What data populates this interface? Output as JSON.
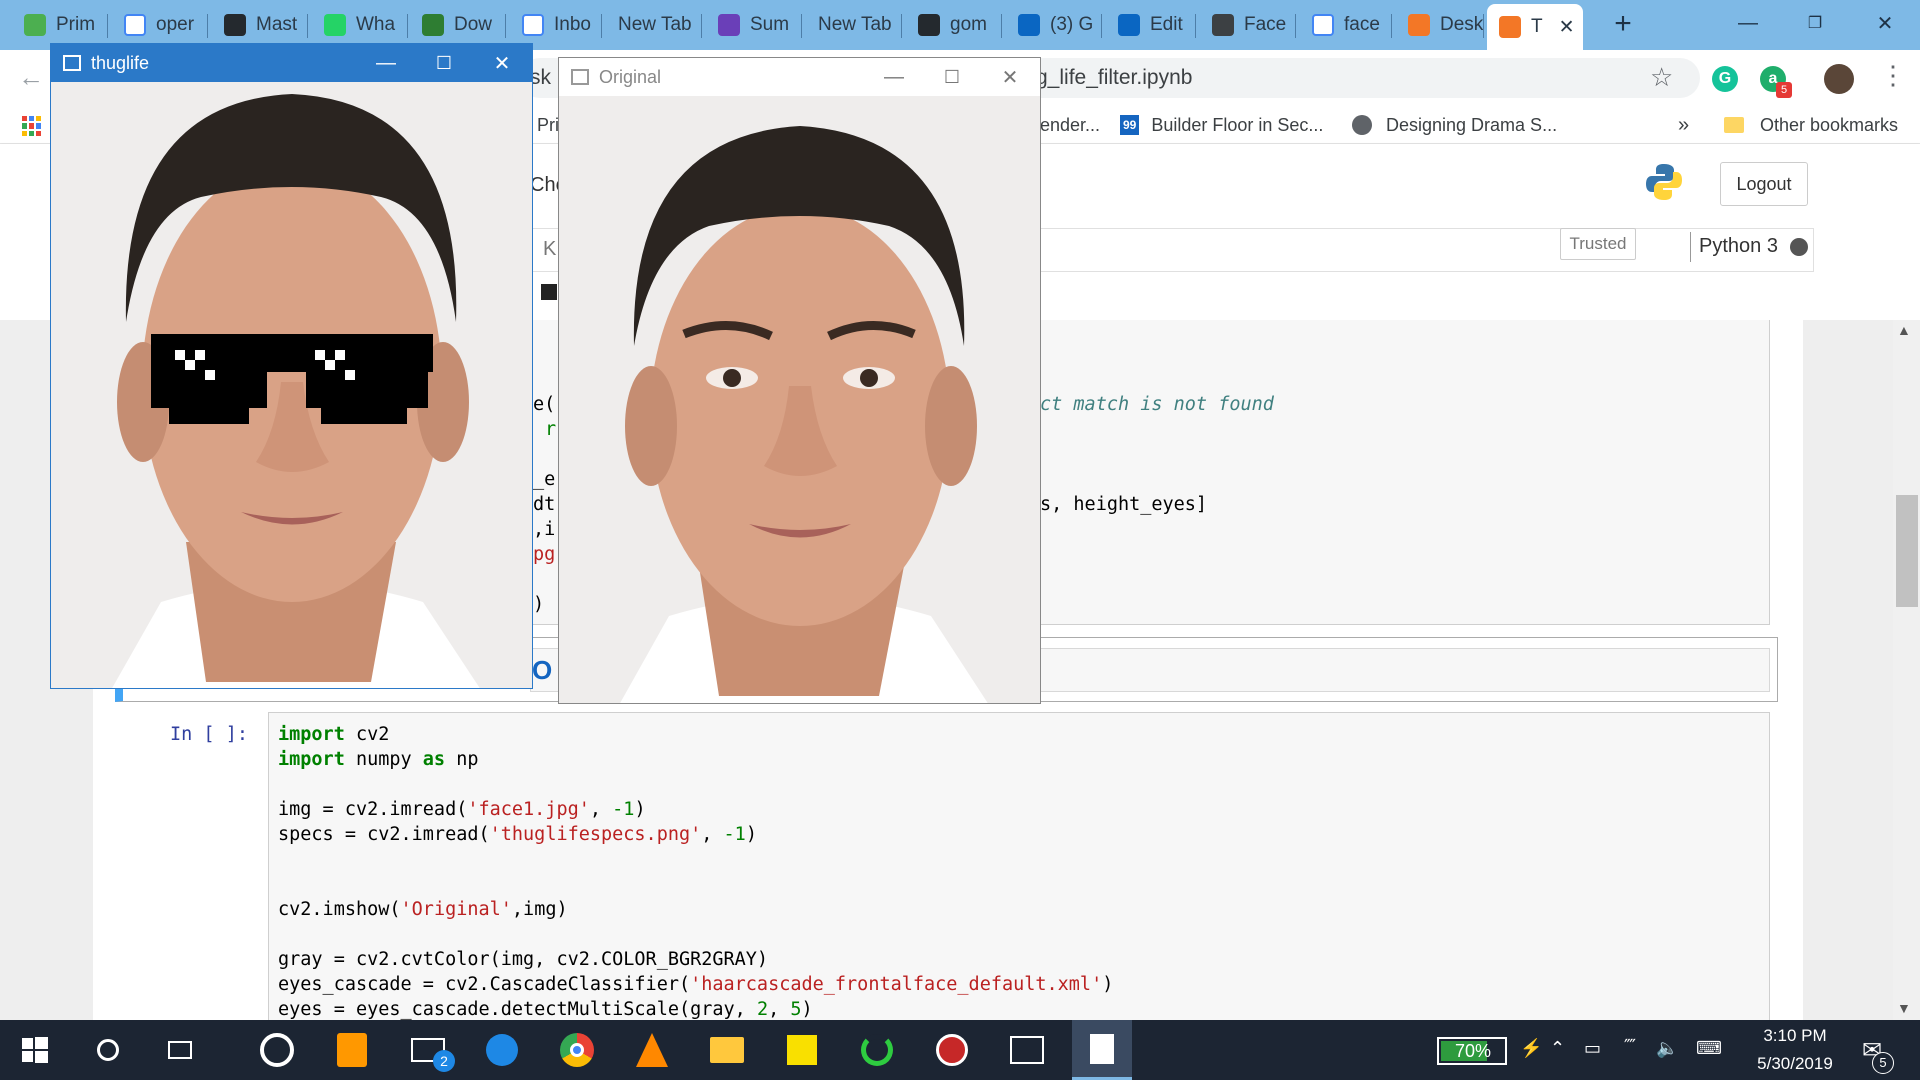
{
  "browser": {
    "tabs": [
      {
        "label": "Prim",
        "favicon": "play-icon",
        "color": "#4caf50"
      },
      {
        "label": "oper",
        "favicon": "google-icon",
        "color": "#ffffff"
      },
      {
        "label": "Mast",
        "favicon": "github-icon",
        "color": "#24292e"
      },
      {
        "label": "Wha",
        "favicon": "whatsapp-icon",
        "color": "#25d366"
      },
      {
        "label": "Dow",
        "favicon": "ftu-icon",
        "color": "#2e7d32"
      },
      {
        "label": "Inbo",
        "favicon": "gmail-icon",
        "color": "#ffffff"
      },
      {
        "label": "New Tab",
        "favicon": "",
        "color": ""
      },
      {
        "label": "Sum",
        "favicon": "list-icon",
        "color": "#6a3fb8"
      },
      {
        "label": "New Tab",
        "favicon": "",
        "color": ""
      },
      {
        "label": "gom",
        "favicon": "github-icon",
        "color": "#24292e"
      },
      {
        "label": "(3) G",
        "favicon": "linkedin-icon",
        "color": "#0a66c2"
      },
      {
        "label": "Edit",
        "favicon": "linkedin-icon",
        "color": "#0a66c2"
      },
      {
        "label": "Face",
        "favicon": "book-icon",
        "color": "#3c4043"
      },
      {
        "label": "face",
        "favicon": "google-icon",
        "color": "#ffffff"
      },
      {
        "label": "Desk",
        "favicon": "jupyter-icon",
        "color": "#f37726"
      },
      {
        "label": "T",
        "favicon": "hourglass-icon",
        "color": "#f37726",
        "active": true
      }
    ],
    "new_tab_label": "+",
    "address": "g_life_filter.ipynb",
    "address_left_fragment": "sk",
    "bookmarks": [
      {
        "label": "Pri"
      },
      {
        "label": "ender..."
      },
      {
        "label": "Builder Floor in Sec...",
        "badge": "99"
      },
      {
        "label": "Designing Drama S..."
      }
    ],
    "bookmarks_more": "»",
    "other_bookmarks": "Other bookmarks",
    "profile_badge": "5"
  },
  "jupyter": {
    "logout_label": "Logout",
    "trusted_label": "Trusted",
    "kernel_label": "Python 3",
    "header_fragment_che": "Che",
    "header_fragment_k": "K",
    "prompt": "In [ ]:",
    "comment_text": "ct match is not found",
    "partial_line": "s, height_eyes]",
    "frag_lines": [
      "e(",
      "r",
      "_e",
      "dt",
      ",i",
      "pg",
      ")"
    ],
    "markdown_fragment": "O",
    "code_lines": [
      [
        {
          "t": "import",
          "c": "kw"
        },
        {
          "t": " cv2",
          "c": ""
        }
      ],
      [
        {
          "t": "import",
          "c": "kw"
        },
        {
          "t": " numpy ",
          "c": ""
        },
        {
          "t": "as",
          "c": "kw"
        },
        {
          "t": " np",
          "c": ""
        }
      ],
      [],
      [
        {
          "t": "img = cv2.imread(",
          "c": ""
        },
        {
          "t": "'face1.jpg'",
          "c": "str"
        },
        {
          "t": ", ",
          "c": ""
        },
        {
          "t": "-1",
          "c": "num"
        },
        {
          "t": ")",
          "c": ""
        }
      ],
      [
        {
          "t": "specs = cv2.imread(",
          "c": ""
        },
        {
          "t": "'thuglifespecs.png'",
          "c": "str"
        },
        {
          "t": ", ",
          "c": ""
        },
        {
          "t": "-1",
          "c": "num"
        },
        {
          "t": ")",
          "c": ""
        }
      ],
      [],
      [],
      [
        {
          "t": "cv2.imshow(",
          "c": ""
        },
        {
          "t": "'Original'",
          "c": "str"
        },
        {
          "t": ",img)",
          "c": ""
        }
      ],
      [],
      [
        {
          "t": "gray = cv2.cvtColor(img, cv2.COLOR_BGR2GRAY)",
          "c": ""
        }
      ],
      [
        {
          "t": "eyes_cascade = cv2.CascadeClassifier(",
          "c": ""
        },
        {
          "t": "'haarcascade_frontalface_default.xml'",
          "c": "str"
        },
        {
          "t": ")",
          "c": ""
        }
      ],
      [
        {
          "t": "eyes = eyes_cascade.detectMultiScale(gray, ",
          "c": ""
        },
        {
          "t": "2",
          "c": "num"
        },
        {
          "t": ", ",
          "c": ""
        },
        {
          "t": "5",
          "c": "num"
        },
        {
          "t": ")",
          "c": ""
        }
      ]
    ]
  },
  "windows": {
    "thuglife": {
      "title": "thuglife"
    },
    "original": {
      "title": "Original"
    }
  },
  "taskbar": {
    "battery": "70%",
    "time": "3:10 PM",
    "date": "5/30/2019",
    "notifications": "5",
    "mail_badge": "2"
  }
}
